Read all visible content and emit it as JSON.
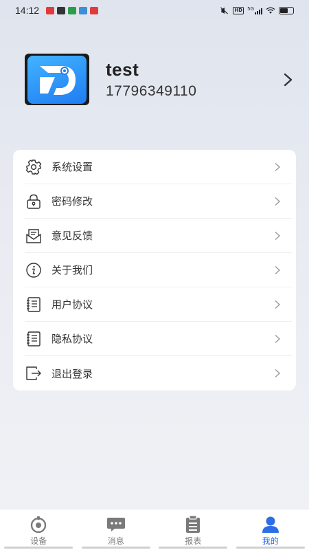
{
  "status_bar": {
    "time": "14:12",
    "network_label": "5G",
    "hd_label": "HD"
  },
  "profile": {
    "name": "test",
    "phone": "17796349110",
    "avatar_icon": "app-logo-icon"
  },
  "menu": {
    "items": [
      {
        "label": "系统设置",
        "icon": "gear-icon"
      },
      {
        "label": "密码修改",
        "icon": "lock-icon"
      },
      {
        "label": "意见反馈",
        "icon": "mail-icon"
      },
      {
        "label": "关于我们",
        "icon": "info-icon"
      },
      {
        "label": "用户协议",
        "icon": "document-icon"
      },
      {
        "label": "隐私协议",
        "icon": "document-icon"
      },
      {
        "label": "退出登录",
        "icon": "logout-icon"
      }
    ]
  },
  "tabs": [
    {
      "label": "设备",
      "icon": "device-icon",
      "active": false
    },
    {
      "label": "消息",
      "icon": "message-icon",
      "active": false
    },
    {
      "label": "报表",
      "icon": "report-icon",
      "active": false
    },
    {
      "label": "我的",
      "icon": "user-icon",
      "active": true
    }
  ],
  "colors": {
    "accent": "#2f6de6",
    "inactive": "#7a7a7a",
    "card": "#ffffff"
  }
}
